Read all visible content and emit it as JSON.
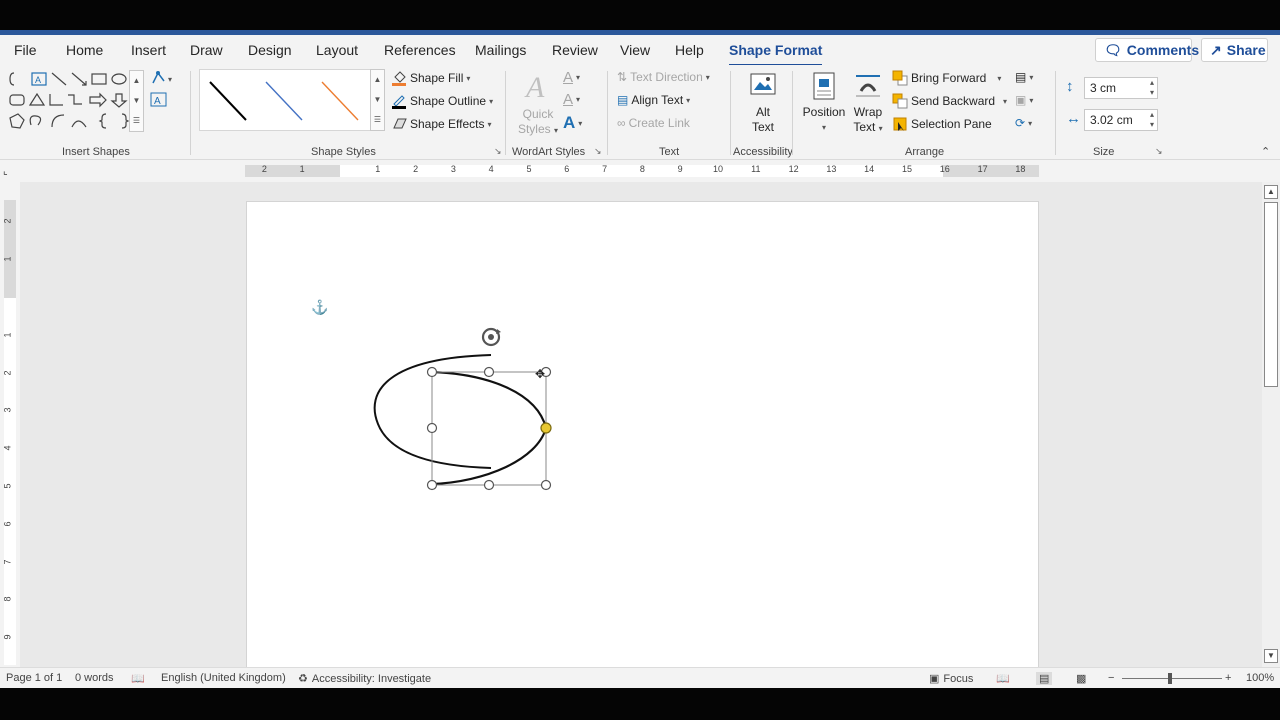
{
  "tabs": [
    {
      "label": "File"
    },
    {
      "label": "Home"
    },
    {
      "label": "Insert"
    },
    {
      "label": "Draw"
    },
    {
      "label": "Design"
    },
    {
      "label": "Layout"
    },
    {
      "label": "References"
    },
    {
      "label": "Mailings"
    },
    {
      "label": "Review"
    },
    {
      "label": "View"
    },
    {
      "label": "Help"
    },
    {
      "label": "Shape Format"
    }
  ],
  "actions": {
    "comments": "Comments",
    "share": "Share"
  },
  "ribbon": {
    "insert_shapes": {
      "label": "Insert Shapes"
    },
    "shape_styles": {
      "label": "Shape Styles",
      "fill": "Shape Fill",
      "outline": "Shape Outline",
      "effects": "Shape Effects",
      "swatch_colors": [
        "#000000",
        "#4472c4",
        "#ed7d31"
      ]
    },
    "wordart": {
      "label": "WordArt Styles",
      "quick_styles_1": "Quick",
      "quick_styles_2": "Styles"
    },
    "text": {
      "label": "Text",
      "direction": "Text Direction",
      "align": "Align Text",
      "link": "Create Link"
    },
    "accessibility": {
      "label": "Accessibility",
      "alt_1": "Alt",
      "alt_2": "Text"
    },
    "arrange": {
      "label": "Arrange",
      "position": "Position",
      "wrap_1": "Wrap",
      "wrap_2": "Text",
      "forward": "Bring Forward",
      "backward": "Send Backward",
      "pane": "Selection Pane"
    },
    "size": {
      "label": "Size",
      "height": "3 cm",
      "width": "3.02 cm"
    }
  },
  "ruler": {
    "h_numbers": [
      "2",
      "1",
      "1",
      "2",
      "3",
      "4",
      "5",
      "6",
      "7",
      "8",
      "9",
      "10",
      "11",
      "12",
      "13",
      "14",
      "15",
      "16",
      "17",
      "18"
    ],
    "v_numbers": [
      "2",
      "1",
      "1",
      "2",
      "3",
      "4",
      "5",
      "6",
      "7",
      "8",
      "9"
    ]
  },
  "status": {
    "page": "Page 1 of 1",
    "words": "0 words",
    "language": "English (United Kingdom)",
    "accessibility": "Accessibility: Investigate",
    "focus": "Focus",
    "zoom": "100%"
  },
  "colors": {
    "accent": "#1f4e99",
    "ribbon_bg": "#f3f3f3",
    "handle_yellow": "#f0d040"
  }
}
